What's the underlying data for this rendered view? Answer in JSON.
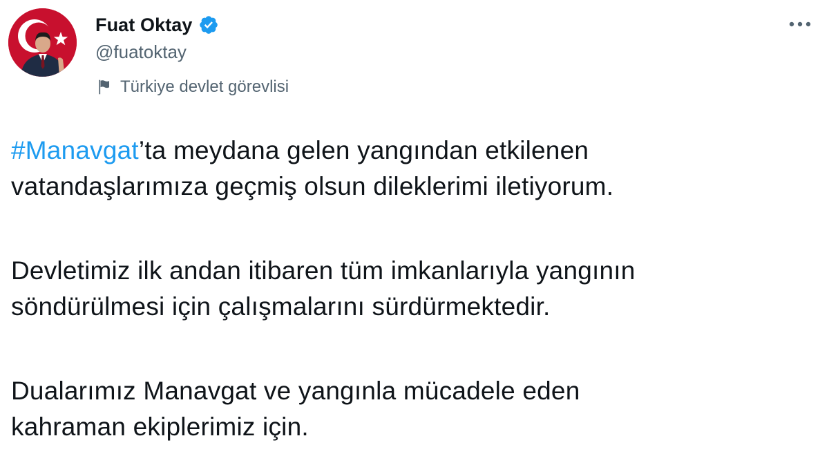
{
  "author": {
    "display_name": "Fuat Oktay",
    "handle": "@fuatoktay",
    "verified": true,
    "label": "Türkiye devlet görevlisi"
  },
  "tweet": {
    "paragraph1": {
      "hashtag": "#Manavgat",
      "rest_line1": "’ta meydana gelen yangından etkilenen",
      "line2": "vatandaşlarımıza geçmiş olsun dileklerimi iletiyorum."
    },
    "paragraph2": {
      "line1": "Devletimiz ilk andan itibaren tüm imkanlarıyla yangının",
      "line2": "söndürülmesi için çalışmalarını sürdürmektedir."
    },
    "paragraph3": {
      "line1": "Dualarımız Manavgat ve yangınla mücadele eden",
      "line2": "kahraman ekiplerimiz için."
    }
  },
  "icons": {
    "verified": "verified-badge-icon",
    "label": "flag-icon",
    "more": "more-dots-icon"
  },
  "colors": {
    "text": "#0f1419",
    "secondary": "#536471",
    "accent": "#1d9bf0",
    "avatar_background": "#c8102e"
  }
}
